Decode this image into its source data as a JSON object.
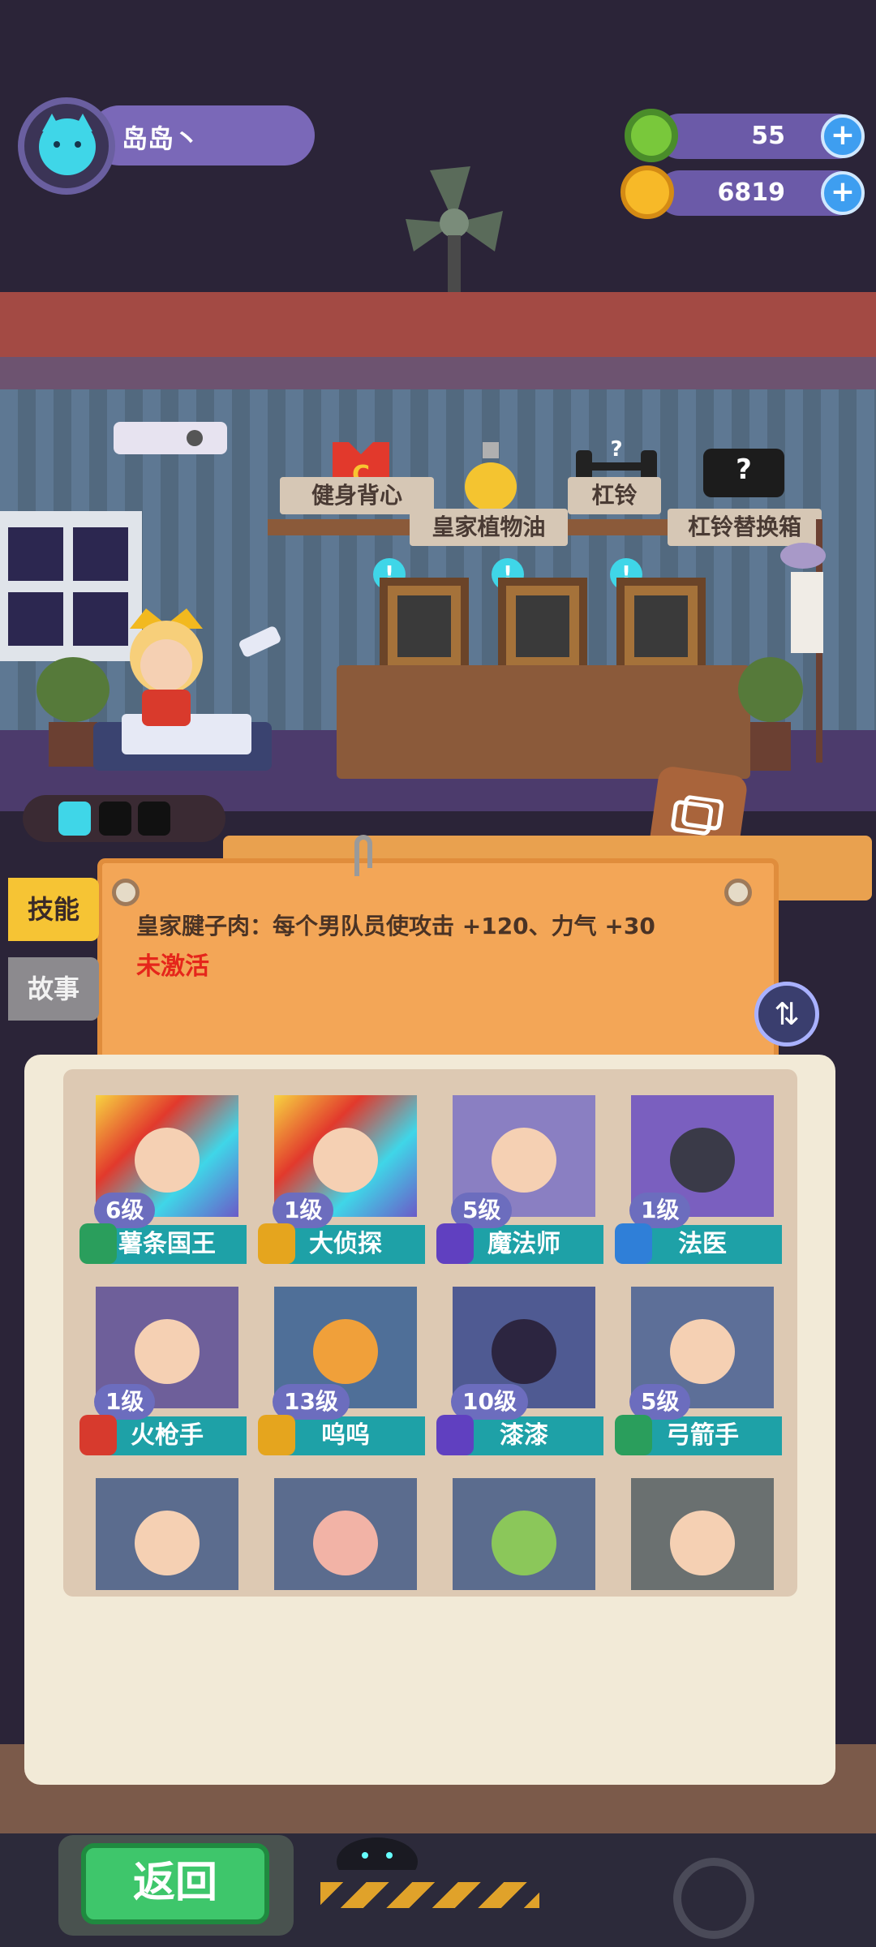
{
  "player": {
    "name": "岛岛丶"
  },
  "resources": [
    {
      "name": "donut",
      "value": "55",
      "icon": "donut-coin-icon"
    },
    {
      "name": "planet",
      "value": "6819",
      "icon": "planet-coin-icon"
    }
  ],
  "plus_symbol": "+",
  "shop_items": [
    {
      "label": "健身背心",
      "icon": "tank-top-icon"
    },
    {
      "label": "皇家植物油",
      "icon": "oil-bottle-icon"
    },
    {
      "label": "杠铃",
      "icon": "barbell-icon"
    },
    {
      "label": "杠铃替换箱",
      "icon": "crate-icon"
    }
  ],
  "info_symbol": "!",
  "board": {
    "text": "皇家腱子肉：每个男队员使攻击 +120、力气 +30",
    "status": "未激活"
  },
  "side_tabs": [
    {
      "label": "技能",
      "active": true
    },
    {
      "label": "故事",
      "active": false
    }
  ],
  "characters": [
    {
      "level": "6级",
      "name": "薯条国王",
      "badge_color": "#2a9e5c",
      "photo_color": "#c79a2a",
      "selected": true
    },
    {
      "level": "1级",
      "name": "大侦探",
      "badge_color": "#e5a51e",
      "photo_color": "#c98a34",
      "selected": false
    },
    {
      "level": "5级",
      "name": "魔法师",
      "badge_color": "#6040c0",
      "photo_color": "#8a7fc2",
      "selected": false
    },
    {
      "level": "1级",
      "name": "法医",
      "badge_color": "#2f7fd8",
      "photo_color": "#7a5fbf",
      "selected": false
    },
    {
      "level": "1级",
      "name": "火枪手",
      "badge_color": "#d73a2d",
      "photo_color": "#6e5f9a",
      "selected": false
    },
    {
      "level": "13级",
      "name": "呜呜",
      "badge_color": "#e5a51e",
      "photo_color": "#4f6f98",
      "selected": false
    },
    {
      "level": "10级",
      "name": "漆漆",
      "badge_color": "#6040c0",
      "photo_color": "#4f5a92",
      "selected": false
    },
    {
      "level": "5级",
      "name": "弓箭手",
      "badge_color": "#2a9e5c",
      "photo_color": "#5d6f98",
      "selected": false
    },
    {
      "level": "",
      "name": "",
      "badge_color": "#2a9e5c",
      "photo_color": "#5b6c8e",
      "selected": false
    },
    {
      "level": "",
      "name": "",
      "badge_color": "#2a9e5c",
      "photo_color": "#5b6c8e",
      "selected": false
    },
    {
      "level": "",
      "name": "",
      "badge_color": "#2a9e5c",
      "photo_color": "#5b6c8e",
      "selected": false
    },
    {
      "level": "",
      "name": "",
      "badge_color": "#2a9e5c",
      "photo_color": "#6a7070",
      "selected": false
    }
  ],
  "footer": {
    "back_label": "返回"
  },
  "colors": {
    "accent": "#f3a657",
    "status_inactive": "#e5261b",
    "name_bar": "#1ea1a7"
  }
}
